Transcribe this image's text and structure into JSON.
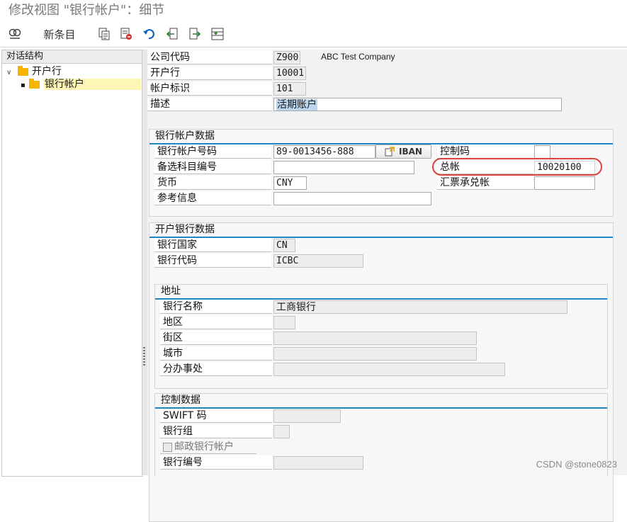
{
  "window": {
    "title": "修改视图 \"银行帐户\"：细节"
  },
  "toolbar": {
    "new_entries_label": "新条目",
    "icons": [
      "display-change-icon",
      "copy-icon",
      "delete-icon",
      "undo-icon",
      "previous-entry-icon",
      "next-entry-icon",
      "select-all-icon"
    ]
  },
  "tree": {
    "header": "对话结构",
    "items": [
      {
        "label": "开户行",
        "expanded": true
      },
      {
        "label": "银行帐户",
        "selected": true
      }
    ]
  },
  "header_fields": {
    "company_code": {
      "label": "公司代码",
      "value": "Z900",
      "desc": "ABC Test Company"
    },
    "house_bank": {
      "label": "开户行",
      "value": "10001"
    },
    "account_id": {
      "label": "帐户标识",
      "value": "101"
    },
    "description": {
      "label": "描述",
      "value": "活期账户"
    }
  },
  "bank_account_data": {
    "title": "银行帐户数据",
    "account_number": {
      "label": "银行帐户号码",
      "value": "89-0013456-888"
    },
    "iban_button": "IBAN",
    "control_key": {
      "label": "控制码",
      "value": ""
    },
    "alt_account": {
      "label": "备选科目编号",
      "value": ""
    },
    "gl_account": {
      "label": "总帐",
      "value": "10020100"
    },
    "currency": {
      "label": "货币",
      "value": "CNY"
    },
    "bills_account": {
      "label": "汇票承兑帐",
      "value": ""
    },
    "reference": {
      "label": "参考信息",
      "value": ""
    }
  },
  "house_bank_data": {
    "title": "开户银行数据",
    "bank_country": {
      "label": "银行国家",
      "value": "CN"
    },
    "bank_key": {
      "label": "银行代码",
      "value": "ICBC"
    }
  },
  "address": {
    "title": "地址",
    "bank_name": {
      "label": "银行名称",
      "value": "工商银行"
    },
    "region": {
      "label": "地区",
      "value": ""
    },
    "street": {
      "label": "街区",
      "value": ""
    },
    "city": {
      "label": "城市",
      "value": ""
    },
    "branch": {
      "label": "分办事处",
      "value": ""
    }
  },
  "control_data": {
    "title": "控制数据",
    "swift": {
      "label": "SWIFT 码",
      "value": ""
    },
    "bank_group": {
      "label": "银行组",
      "value": ""
    },
    "postal_bank": {
      "label": "邮政银行帐户",
      "checked": false
    },
    "bank_number": {
      "label": "银行编号",
      "value": ""
    }
  },
  "watermark": "CSDN @stone0823",
  "colors": {
    "accent": "#1e86c7",
    "highlight": "#d9453b",
    "folder": "#f4b400",
    "selection": "#fdf6b5"
  }
}
